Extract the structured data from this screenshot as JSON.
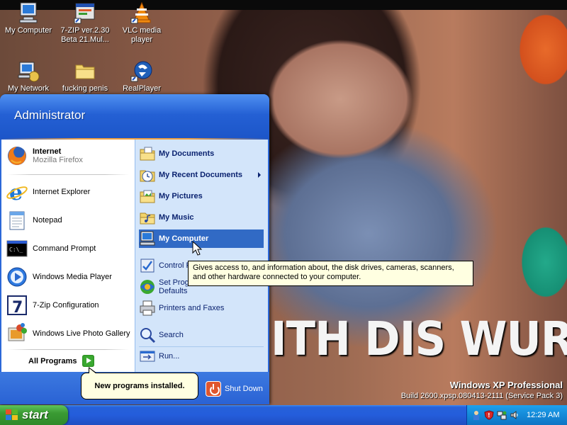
{
  "desktop": {
    "icons": [
      {
        "label": "My Computer",
        "icon": "my-computer-icon"
      },
      {
        "label": "7-ZIP ver.2.30 Beta 21.Mul...",
        "icon": "installer-icon"
      },
      {
        "label": "VLC media player",
        "icon": "vlc-cone-icon"
      },
      {
        "label": "My Network",
        "icon": "network-icon"
      },
      {
        "label": "fucking penis",
        "icon": "folder-icon"
      },
      {
        "label": "RealPlayer",
        "icon": "realplayer-icon"
      }
    ],
    "wallpaper_text": "ITH DIS WURLD",
    "brand_line1": "Windows XP Professional",
    "brand_line2": "Build 2600.xpsp.080413-2111 (Service Pack 3)"
  },
  "start_menu": {
    "user": "Administrator",
    "left_items": [
      {
        "label": "Internet",
        "sub": "Mozilla Firefox",
        "icon": "firefox-icon"
      },
      {
        "label": "Internet Explorer",
        "icon": "internet-explorer-icon"
      },
      {
        "label": "Notepad",
        "icon": "notepad-icon"
      },
      {
        "label": "Command Prompt",
        "icon": "command-prompt-icon"
      },
      {
        "label": "Windows Media Player",
        "icon": "media-player-icon"
      },
      {
        "label": "7-Zip Configuration",
        "icon": "seven-zip-icon"
      },
      {
        "label": "Windows Live Photo Gallery",
        "icon": "photo-gallery-icon"
      }
    ],
    "all_programs": "All Programs",
    "right_items": [
      {
        "label": "My Documents",
        "icon": "documents-folder-icon"
      },
      {
        "label": "My Recent Documents",
        "icon": "recent-documents-icon"
      },
      {
        "label": "My Pictures",
        "icon": "pictures-folder-icon"
      },
      {
        "label": "My Music",
        "icon": "music-folder-icon"
      },
      {
        "label": "My Computer",
        "icon": "my-computer-icon"
      },
      {
        "label": "Control P",
        "icon": "control-panel-icon"
      },
      {
        "label": "Set Progr",
        "label2": "Defaults",
        "icon": "program-defaults-icon"
      },
      {
        "label": "Printers and Faxes",
        "icon": "printer-icon"
      },
      {
        "label": "Search",
        "icon": "search-icon"
      },
      {
        "label": "Run...",
        "icon": "run-icon"
      }
    ],
    "shutdown": "Shut Down"
  },
  "tooltip": "Gives access to, and information about, the disk drives, cameras, scanners, and other hardware connected to your computer.",
  "balloon": "New programs installed.",
  "taskbar": {
    "start_label": "start",
    "clock": "12:29 AM"
  },
  "colors": {
    "taskbar_blue": "#245ddb",
    "start_green": "#3a9a33",
    "selection_blue": "#316ac5",
    "tooltip_bg": "#ffffe1"
  }
}
